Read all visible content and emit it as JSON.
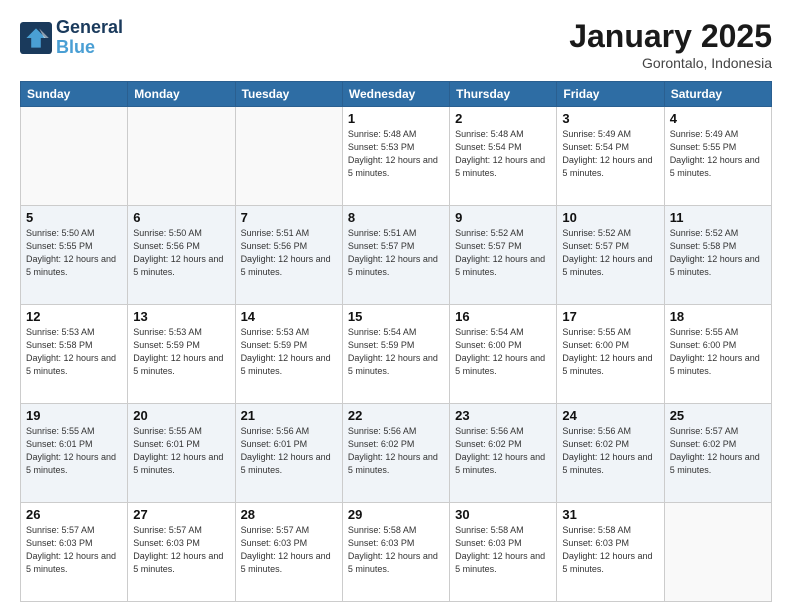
{
  "logo": {
    "line1": "General",
    "line2": "Blue"
  },
  "title": "January 2025",
  "location": "Gorontalo, Indonesia",
  "days_of_week": [
    "Sunday",
    "Monday",
    "Tuesday",
    "Wednesday",
    "Thursday",
    "Friday",
    "Saturday"
  ],
  "weeks": [
    [
      {
        "day": "",
        "info": ""
      },
      {
        "day": "",
        "info": ""
      },
      {
        "day": "",
        "info": ""
      },
      {
        "day": "1",
        "info": "Sunrise: 5:48 AM\nSunset: 5:53 PM\nDaylight: 12 hours\nand 5 minutes."
      },
      {
        "day": "2",
        "info": "Sunrise: 5:48 AM\nSunset: 5:54 PM\nDaylight: 12 hours\nand 5 minutes."
      },
      {
        "day": "3",
        "info": "Sunrise: 5:49 AM\nSunset: 5:54 PM\nDaylight: 12 hours\nand 5 minutes."
      },
      {
        "day": "4",
        "info": "Sunrise: 5:49 AM\nSunset: 5:55 PM\nDaylight: 12 hours\nand 5 minutes."
      }
    ],
    [
      {
        "day": "5",
        "info": "Sunrise: 5:50 AM\nSunset: 5:55 PM\nDaylight: 12 hours\nand 5 minutes."
      },
      {
        "day": "6",
        "info": "Sunrise: 5:50 AM\nSunset: 5:56 PM\nDaylight: 12 hours\nand 5 minutes."
      },
      {
        "day": "7",
        "info": "Sunrise: 5:51 AM\nSunset: 5:56 PM\nDaylight: 12 hours\nand 5 minutes."
      },
      {
        "day": "8",
        "info": "Sunrise: 5:51 AM\nSunset: 5:57 PM\nDaylight: 12 hours\nand 5 minutes."
      },
      {
        "day": "9",
        "info": "Sunrise: 5:52 AM\nSunset: 5:57 PM\nDaylight: 12 hours\nand 5 minutes."
      },
      {
        "day": "10",
        "info": "Sunrise: 5:52 AM\nSunset: 5:57 PM\nDaylight: 12 hours\nand 5 minutes."
      },
      {
        "day": "11",
        "info": "Sunrise: 5:52 AM\nSunset: 5:58 PM\nDaylight: 12 hours\nand 5 minutes."
      }
    ],
    [
      {
        "day": "12",
        "info": "Sunrise: 5:53 AM\nSunset: 5:58 PM\nDaylight: 12 hours\nand 5 minutes."
      },
      {
        "day": "13",
        "info": "Sunrise: 5:53 AM\nSunset: 5:59 PM\nDaylight: 12 hours\nand 5 minutes."
      },
      {
        "day": "14",
        "info": "Sunrise: 5:53 AM\nSunset: 5:59 PM\nDaylight: 12 hours\nand 5 minutes."
      },
      {
        "day": "15",
        "info": "Sunrise: 5:54 AM\nSunset: 5:59 PM\nDaylight: 12 hours\nand 5 minutes."
      },
      {
        "day": "16",
        "info": "Sunrise: 5:54 AM\nSunset: 6:00 PM\nDaylight: 12 hours\nand 5 minutes."
      },
      {
        "day": "17",
        "info": "Sunrise: 5:55 AM\nSunset: 6:00 PM\nDaylight: 12 hours\nand 5 minutes."
      },
      {
        "day": "18",
        "info": "Sunrise: 5:55 AM\nSunset: 6:00 PM\nDaylight: 12 hours\nand 5 minutes."
      }
    ],
    [
      {
        "day": "19",
        "info": "Sunrise: 5:55 AM\nSunset: 6:01 PM\nDaylight: 12 hours\nand 5 minutes."
      },
      {
        "day": "20",
        "info": "Sunrise: 5:55 AM\nSunset: 6:01 PM\nDaylight: 12 hours\nand 5 minutes."
      },
      {
        "day": "21",
        "info": "Sunrise: 5:56 AM\nSunset: 6:01 PM\nDaylight: 12 hours\nand 5 minutes."
      },
      {
        "day": "22",
        "info": "Sunrise: 5:56 AM\nSunset: 6:02 PM\nDaylight: 12 hours\nand 5 minutes."
      },
      {
        "day": "23",
        "info": "Sunrise: 5:56 AM\nSunset: 6:02 PM\nDaylight: 12 hours\nand 5 minutes."
      },
      {
        "day": "24",
        "info": "Sunrise: 5:56 AM\nSunset: 6:02 PM\nDaylight: 12 hours\nand 5 minutes."
      },
      {
        "day": "25",
        "info": "Sunrise: 5:57 AM\nSunset: 6:02 PM\nDaylight: 12 hours\nand 5 minutes."
      }
    ],
    [
      {
        "day": "26",
        "info": "Sunrise: 5:57 AM\nSunset: 6:03 PM\nDaylight: 12 hours\nand 5 minutes."
      },
      {
        "day": "27",
        "info": "Sunrise: 5:57 AM\nSunset: 6:03 PM\nDaylight: 12 hours\nand 5 minutes."
      },
      {
        "day": "28",
        "info": "Sunrise: 5:57 AM\nSunset: 6:03 PM\nDaylight: 12 hours\nand 5 minutes."
      },
      {
        "day": "29",
        "info": "Sunrise: 5:58 AM\nSunset: 6:03 PM\nDaylight: 12 hours\nand 5 minutes."
      },
      {
        "day": "30",
        "info": "Sunrise: 5:58 AM\nSunset: 6:03 PM\nDaylight: 12 hours\nand 5 minutes."
      },
      {
        "day": "31",
        "info": "Sunrise: 5:58 AM\nSunset: 6:03 PM\nDaylight: 12 hours\nand 5 minutes."
      },
      {
        "day": "",
        "info": ""
      }
    ]
  ]
}
